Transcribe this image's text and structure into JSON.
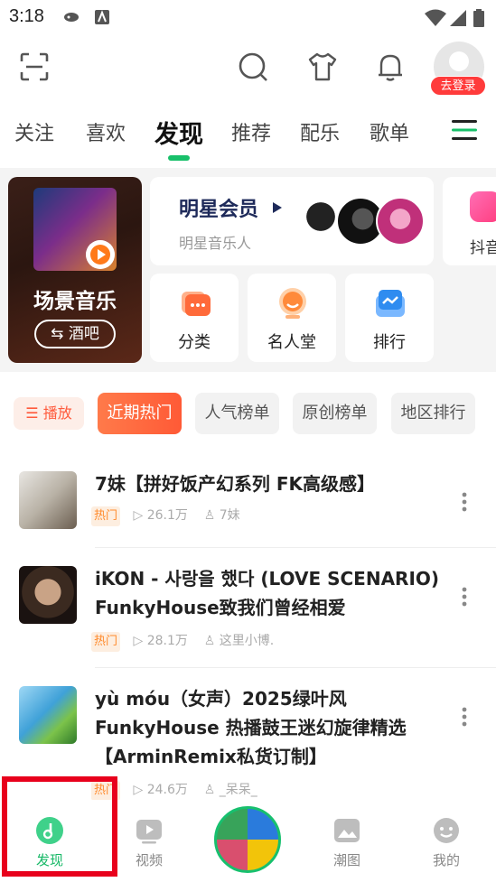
{
  "status_bar": {
    "time": "3:18"
  },
  "top_bar": {
    "login_badge": "去登录"
  },
  "tabs": [
    {
      "label": "关注"
    },
    {
      "label": "喜欢"
    },
    {
      "label": "发现",
      "active": true
    },
    {
      "label": "推荐"
    },
    {
      "label": "配乐"
    },
    {
      "label": "歌单"
    }
  ],
  "feature": {
    "scene_card": {
      "title": "场景音乐",
      "pill": "酒吧",
      "pill_icon": "swap-icon"
    },
    "vip_card": {
      "title": "明星会员",
      "subtitle": "明星音乐人"
    },
    "douyin_card": {
      "label": "抖音"
    },
    "small_cards": [
      {
        "label": "分类",
        "icon": "category-icon"
      },
      {
        "label": "名人堂",
        "icon": "hall-of-fame-icon"
      },
      {
        "label": "排行",
        "icon": "ranking-icon"
      }
    ]
  },
  "chips": {
    "play": "播放",
    "items": [
      {
        "label": "近期热门",
        "active": true
      },
      {
        "label": "人气榜单"
      },
      {
        "label": "原创榜单"
      },
      {
        "label": "地区排行"
      }
    ]
  },
  "songs": [
    {
      "title": "7妹【拼好饭产幻系列 FK高级感】",
      "tag": "热门",
      "plays": "26.1万",
      "author": "7妹"
    },
    {
      "title": "iKON - 사랑을 했다 (LOVE SCENARIO) FunkyHouse致我们曾经相爱",
      "tag": "热门",
      "plays": "28.1万",
      "author": "这里小博."
    },
    {
      "title": "yù móu（女声）2025绿叶风 FunkyHouse 热播鼓王迷幻旋律精选【ArminRemix私货订制】",
      "tag": "热门",
      "plays": "24.6万",
      "author": "_呆呆_"
    }
  ],
  "bottom_nav": [
    {
      "label": "发现",
      "active": true
    },
    {
      "label": "视频"
    },
    {
      "label": ""
    },
    {
      "label": "潮图"
    },
    {
      "label": "我的"
    }
  ],
  "colors": {
    "accent": "#18c06a",
    "hot": "#ff5a36",
    "badge": "#ff3b3b"
  }
}
